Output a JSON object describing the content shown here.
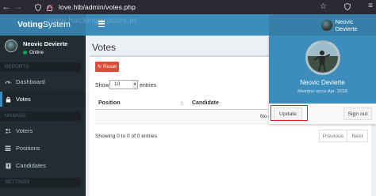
{
  "browser": {
    "url": "love.htb/admin/votes.php"
  },
  "app": {
    "logo_bold": "Voting",
    "logo_rest": "System",
    "watermark": "www.hackingarticles.in",
    "nav_user_name": "Neovic Devierte"
  },
  "sidebar": {
    "user_name": "Neovic Devierte",
    "status": "Online",
    "headers": [
      "REPORTS",
      "MANAGE",
      "SETTINGS"
    ],
    "items": [
      {
        "label": "Dashboard",
        "icon": "dashboard-icon"
      },
      {
        "label": "Votes",
        "icon": "lock-icon",
        "active": true
      },
      {
        "label": "Voters",
        "icon": "users-icon"
      },
      {
        "label": "Positions",
        "icon": "tasks-icon"
      },
      {
        "label": "Candidates",
        "icon": "black-tie-icon"
      }
    ]
  },
  "content": {
    "title": "Votes",
    "reset_label": "Reset",
    "show_label": "Show",
    "page_length": "10",
    "entries_label": "entries",
    "columns": [
      "Position",
      "Candidate"
    ],
    "empty_message": "No data available in table",
    "info": "Showing 0 to 0 of 0 entries",
    "prev_label": "Previous",
    "next_label": "Next"
  },
  "dropdown": {
    "name": "Neovic Devierte",
    "member_since": "Member since Apr. 2018",
    "update_label": "Update",
    "signout_label": "Sign out"
  },
  "colors": {
    "primary": "#3c8dbc",
    "sidebar": "#222d32",
    "danger": "#dd4b39",
    "online": "#00a65a"
  }
}
